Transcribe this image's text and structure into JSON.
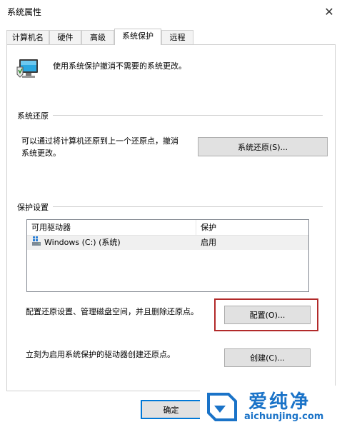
{
  "window": {
    "title": "系统属性",
    "close_glyph": "✕"
  },
  "tabs": [
    {
      "label": "计算机名",
      "active": false
    },
    {
      "label": "硬件",
      "active": false
    },
    {
      "label": "高级",
      "active": false
    },
    {
      "label": "系统保护",
      "active": true
    },
    {
      "label": "远程",
      "active": false
    }
  ],
  "header": {
    "description": "使用系统保护撤消不需要的系统更改。",
    "icon": "computer-shield-icon"
  },
  "restore": {
    "group_label": "系统还原",
    "text_line1": "可以通过将计算机还原到上一个还原点，撤消",
    "text_line2": "系统更改。",
    "button_label": "系统还原(S)..."
  },
  "protection": {
    "group_label": "保护设置",
    "columns": [
      "可用驱动器",
      "保护"
    ],
    "rows": [
      {
        "drive": "Windows (C:) (系统)",
        "status": "启用",
        "icon": "drive-icon"
      }
    ],
    "configure_text": "配置还原设置、管理磁盘空间，并且删除还原点。",
    "configure_button": "配置(O)...",
    "create_text": "立刻为启用系统保护的驱动器创建还原点。",
    "create_button": "创建(C)..."
  },
  "footer": {
    "ok_button": "确定"
  },
  "watermark": {
    "brand": "爱纯净",
    "url": "aichunjing.com"
  },
  "colors": {
    "highlight": "#b22a2a",
    "default_button_border": "#0078d7",
    "watermark": "#1a73c8"
  }
}
